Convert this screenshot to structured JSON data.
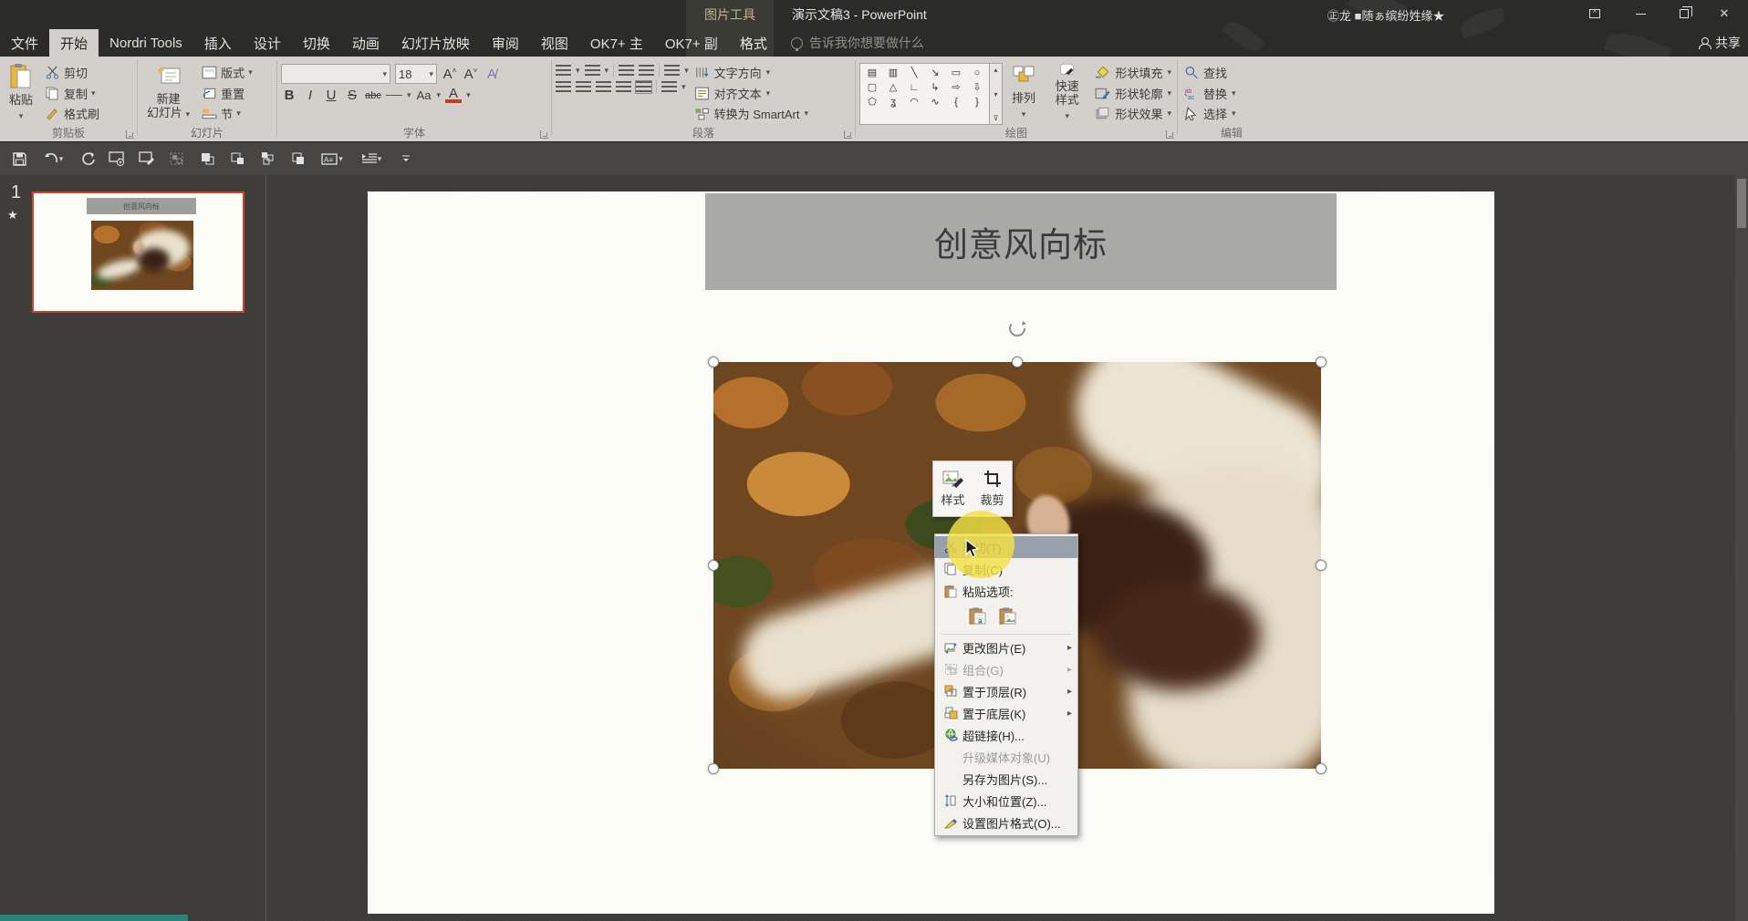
{
  "titlebar": {
    "contextual_tool": "图片工具",
    "title": "演示文稿3 - PowerPoint",
    "user": "㊣龙 ■随ぁ缤纷姓缘★",
    "share": "共享"
  },
  "tabs": [
    {
      "label": "文件"
    },
    {
      "label": "开始",
      "active": true
    },
    {
      "label": "Nordri Tools"
    },
    {
      "label": "插入"
    },
    {
      "label": "设计"
    },
    {
      "label": "切换"
    },
    {
      "label": "动画"
    },
    {
      "label": "幻灯片放映"
    },
    {
      "label": "审阅"
    },
    {
      "label": "视图"
    },
    {
      "label": "OK7+ 主"
    },
    {
      "label": "OK7+ 副"
    },
    {
      "label": "格式",
      "contextual": true
    }
  ],
  "tellme": "告诉我你想要做什么",
  "ribbon": {
    "clipboard": {
      "group_label": "剪贴板",
      "paste": "粘贴",
      "cut": "剪切",
      "copy": "复制",
      "format_painter": "格式刷"
    },
    "slides": {
      "group_label": "幻灯片",
      "new_slide_line1": "新建",
      "new_slide_line2": "幻灯片",
      "layout": "版式",
      "reset": "重置",
      "section": "节"
    },
    "font": {
      "group_label": "字体",
      "font_size": "18",
      "bold": "B",
      "italic": "I",
      "underline": "U",
      "strike": "S",
      "clear_abc": "abc",
      "spacing_av": "AV",
      "case_aa": "Aa",
      "color_a": "A"
    },
    "paragraph": {
      "group_label": "段落",
      "text_direction": "文字方向",
      "align_text": "对齐文本",
      "smartart": "转换为 SmartArt"
    },
    "drawing": {
      "group_label": "绘图",
      "arrange": "排列",
      "quick_styles": "快速样式",
      "shape_fill": "形状填充",
      "shape_outline": "形状轮廓",
      "shape_effects": "形状效果",
      "shape_gallery_icons": [
        "text-box",
        "vertical-text-box",
        "line",
        "arrow",
        "rectangle",
        "oval",
        "rounded-rectangle",
        "triangle",
        "elbow-connector",
        "elbow-arrow",
        "right-arrow",
        "down-arrow",
        "freeform",
        "scribble",
        "arc",
        "curve",
        "left-brace",
        "right-brace"
      ]
    },
    "editing": {
      "group_label": "编辑",
      "find": "查找",
      "replace": "替换",
      "select": "选择"
    }
  },
  "qat_icons": [
    "save",
    "undo",
    "redo",
    "start-slideshow",
    "slideshow-pen",
    "group",
    "bring-forward",
    "send-backward",
    "bring-to-front",
    "send-to-back",
    "text-box",
    "indent",
    "customize-toolbar"
  ],
  "slide_panel": {
    "number": "1"
  },
  "slide": {
    "title": "创意风向标"
  },
  "mini_toolbar": {
    "style": "样式",
    "crop": "裁剪"
  },
  "context_menu": {
    "items": [
      {
        "label": "剪切(T)",
        "icon": "cut",
        "highlighted": true
      },
      {
        "label": "复制(C)",
        "icon": "copy"
      },
      {
        "label": "粘贴选项:",
        "icon": "paste",
        "header": true
      },
      {
        "label": "更改图片(E)",
        "icon": "change-picture",
        "submenu": true
      },
      {
        "label": "组合(G)",
        "icon": "group",
        "submenu": true,
        "disabled": true
      },
      {
        "label": "置于顶层(R)",
        "icon": "bring-to-front",
        "submenu": true
      },
      {
        "label": "置于底层(K)",
        "icon": "send-to-back",
        "submenu": true
      },
      {
        "label": "超链接(H)...",
        "icon": "hyperlink"
      },
      {
        "label": "升级媒体对象(U)",
        "disabled": true
      },
      {
        "label": "另存为图片(S)..."
      },
      {
        "label": "大小和位置(Z)...",
        "icon": "size-position"
      },
      {
        "label": "设置图片格式(O)...",
        "icon": "format-picture"
      }
    ],
    "paste_option_icons": [
      "paste-keep-source-formatting",
      "paste-as-picture"
    ]
  },
  "colors": {
    "titlebar": "#2b2b2a",
    "ribbon_bg": "#d3d0cb",
    "content_bg": "#3d3c3a",
    "thumbnail_selection": "#d1402a",
    "slide_title_bg": "#a9a9a7",
    "menu_highlight": "#98a1ab",
    "click_highlight": "#f3e046",
    "progress_teal": "#2c8377"
  }
}
